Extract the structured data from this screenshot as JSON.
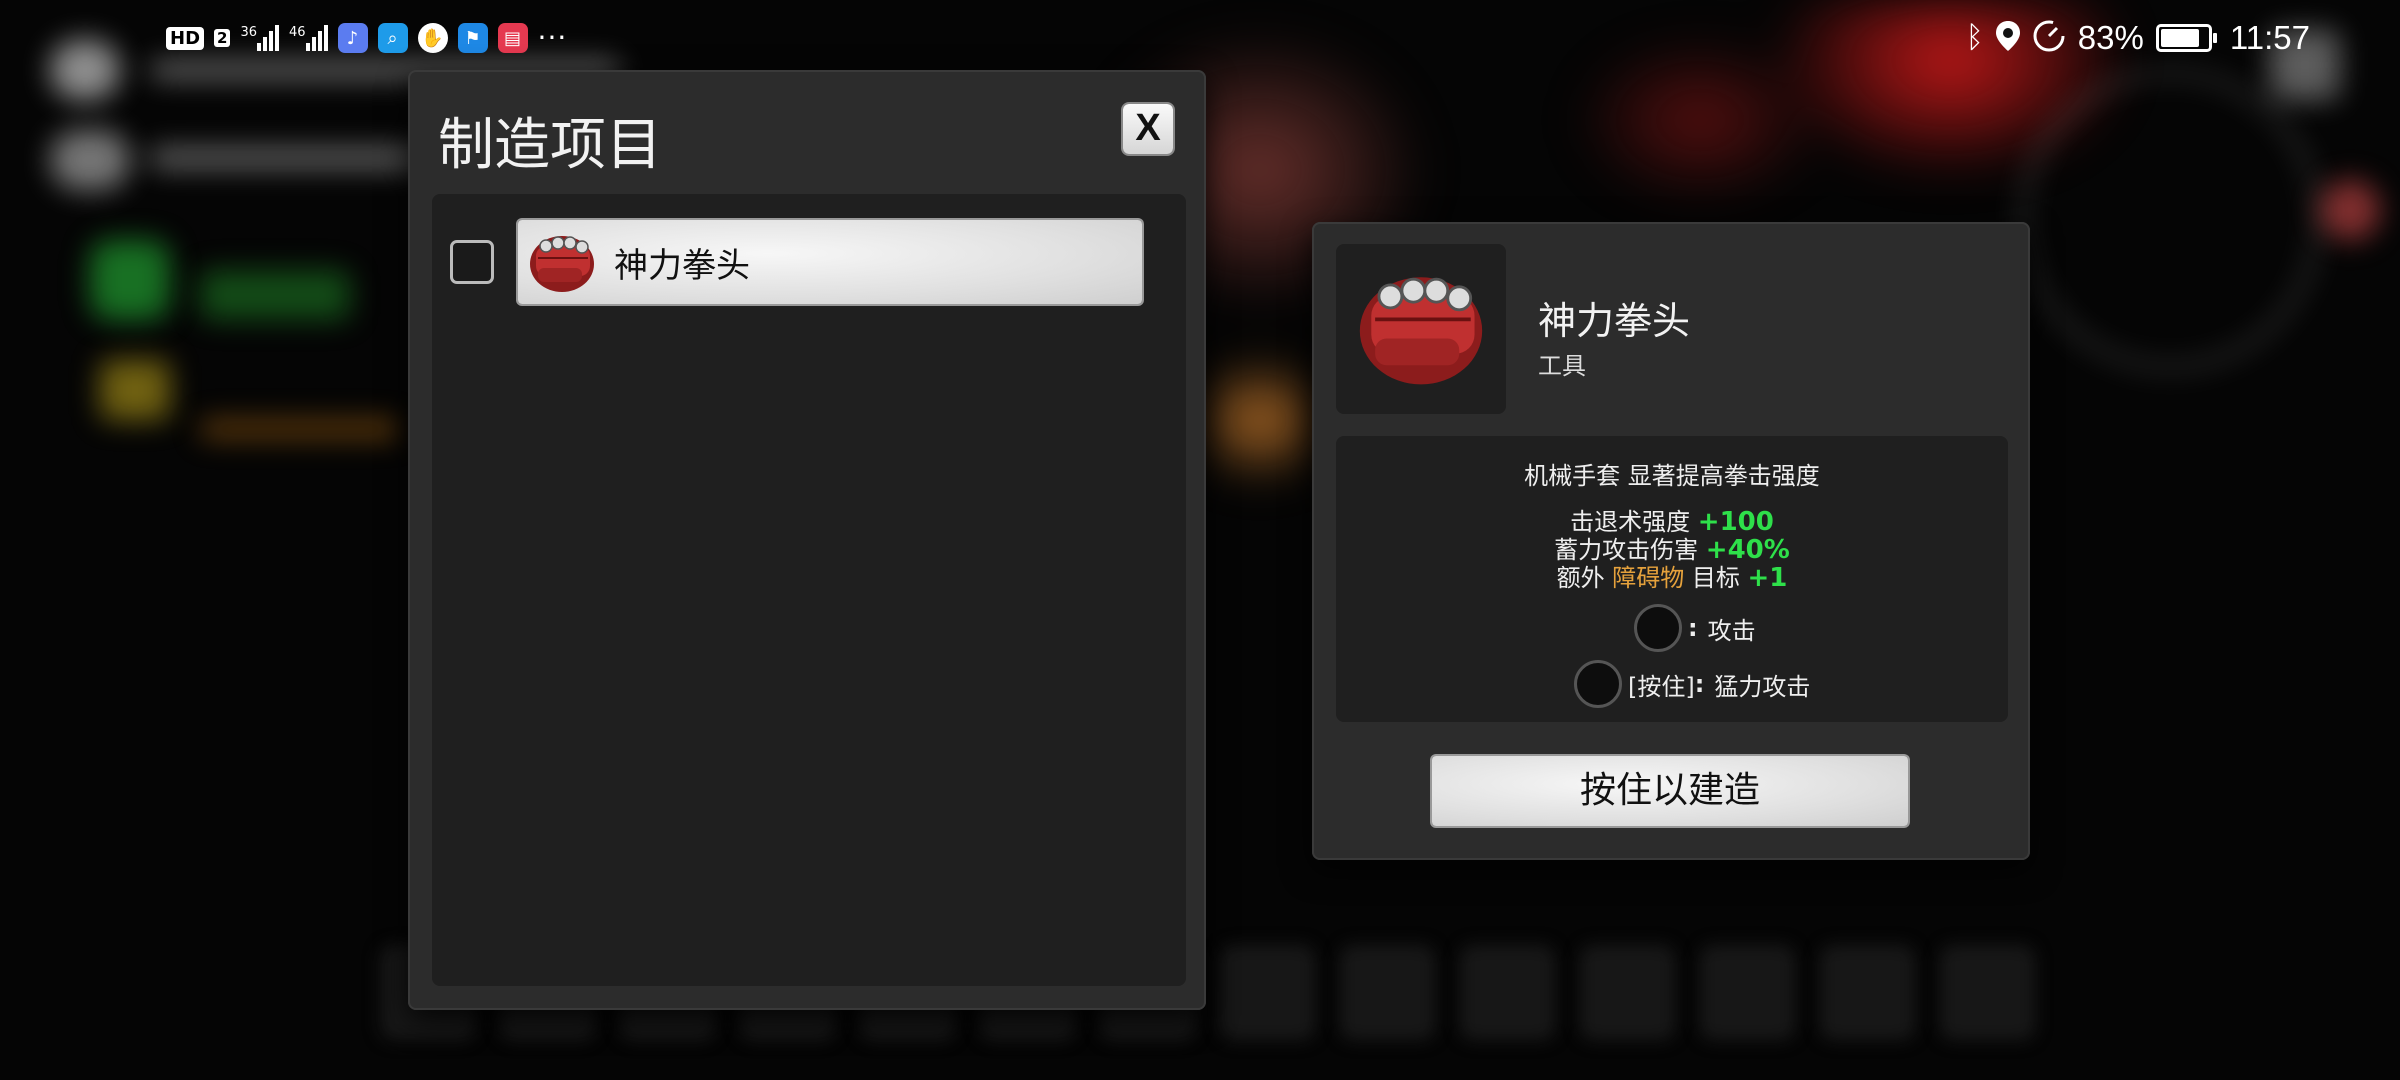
{
  "status_bar": {
    "left": {
      "hd_badge": "HD",
      "sim_badge": "2",
      "net1": "36",
      "net2": "46",
      "overflow": "···"
    },
    "right": {
      "battery_percent": "83%",
      "battery_level": 0.83,
      "time": "11:57"
    },
    "icons": [
      "hd-badge",
      "sim2-badge",
      "signal-3g-icon",
      "signal-4g-icon",
      "music-app-icon",
      "search-app-icon",
      "hand-app-icon",
      "flag-app-icon",
      "book-app-icon",
      "more-dots-icon",
      "bluetooth-icon",
      "location-icon",
      "speed-icon",
      "battery-charging-icon"
    ]
  },
  "craft_panel": {
    "title": "制造项目",
    "close_label": "X",
    "items": [
      {
        "label": "神力拳头",
        "icon": "power-fist-icon",
        "checked": false
      }
    ]
  },
  "detail_panel": {
    "name": "神力拳头",
    "type": "工具",
    "description": "机械手套 显著提高拳击强度",
    "stats": [
      {
        "label": "击退术强度",
        "value": "+100"
      },
      {
        "label": "蓄力攻击伤害",
        "value": "+40%"
      },
      {
        "prefix": "额外",
        "highlight": "障碍物",
        "label": "目标",
        "value": "+1"
      }
    ],
    "controls": [
      {
        "key_prefix": "",
        "colon": ":",
        "action": "攻击"
      },
      {
        "key_prefix": "[按住]",
        "colon": ":",
        "action": "猛力攻击"
      }
    ],
    "build_button": "按住以建造"
  },
  "colors": {
    "positive": "#2ee04a",
    "highlight": "#e6a23c",
    "panel": "#2c2c2c",
    "inner": "#1f1f1f"
  }
}
